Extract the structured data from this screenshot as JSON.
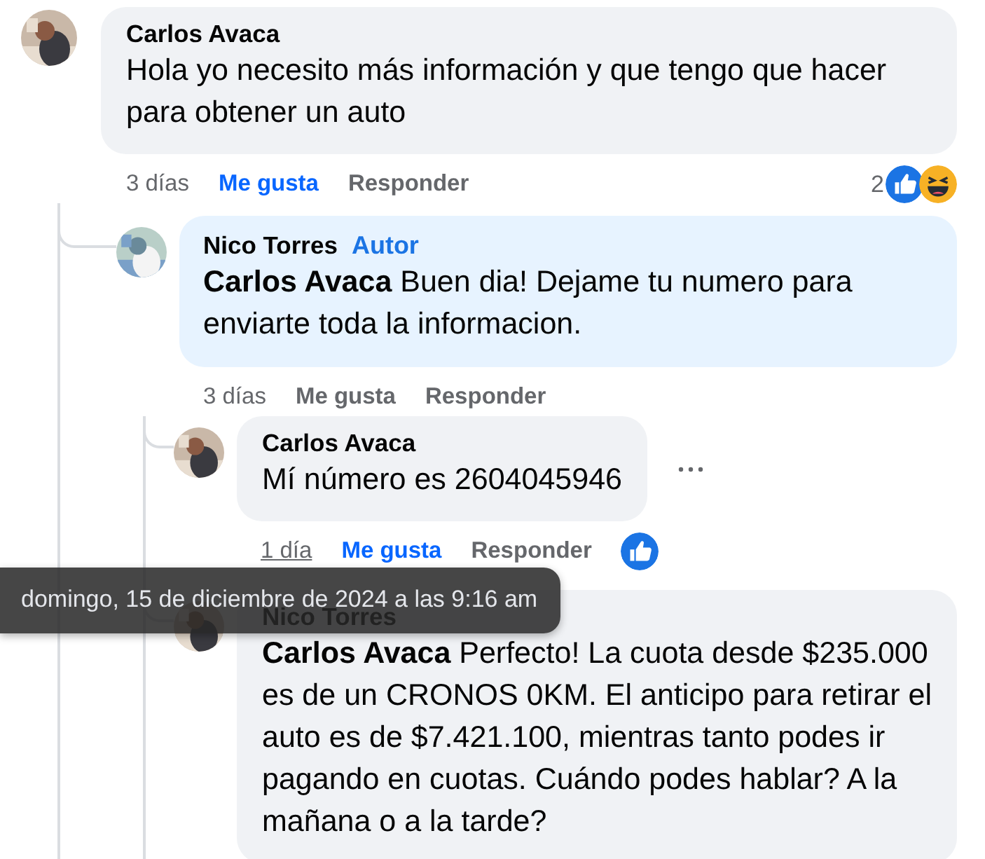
{
  "comments": [
    {
      "author": "Carlos Avaca",
      "highlighted": false,
      "text": "Hola yo necesito más información y que tengo que hacer para obtener un auto",
      "time": "3 días",
      "time_hovered": false,
      "like_label": "Me gusta",
      "liked": true,
      "reply_label": "Responder",
      "reaction_count": "2",
      "reactions": [
        {
          "kind": "like"
        },
        {
          "kind": "haha"
        }
      ],
      "children": [
        {
          "author": "Nico Torres",
          "badge": "Autor",
          "highlighted": true,
          "text": "**Carlos Avaca** Buen dia! Dejame tu numero para enviarte toda la informacion.",
          "time": "3 días",
          "time_hovered": false,
          "like_label": "Me gusta",
          "liked": false,
          "reply_label": "Responder",
          "children": [
            {
              "author": "Carlos Avaca",
              "highlighted": false,
              "text": "Mí número es 2604045946",
              "time": "1 día",
              "time_hovered": true,
              "like_label": "Me gusta",
              "liked": true,
              "reply_label": "Responder",
              "reactions": [
                {
                  "kind": "like"
                }
              ],
              "more_menu": true
            },
            {
              "author": "Nico Torres",
              "highlighted": false,
              "text": "**Carlos Avaca** Perfecto! La cuota desde $235.000 es de un CRONOS 0KM. El anticipo para retirar el auto es de $7.421.100, mientras tanto podes ir pagando en cuotas. Cuándo podes hablar? A la mañana o a la tarde?"
            }
          ]
        }
      ]
    }
  ],
  "tooltip": {
    "text": "domingo, 15 de diciembre de 2024 a las 9:16 am"
  }
}
